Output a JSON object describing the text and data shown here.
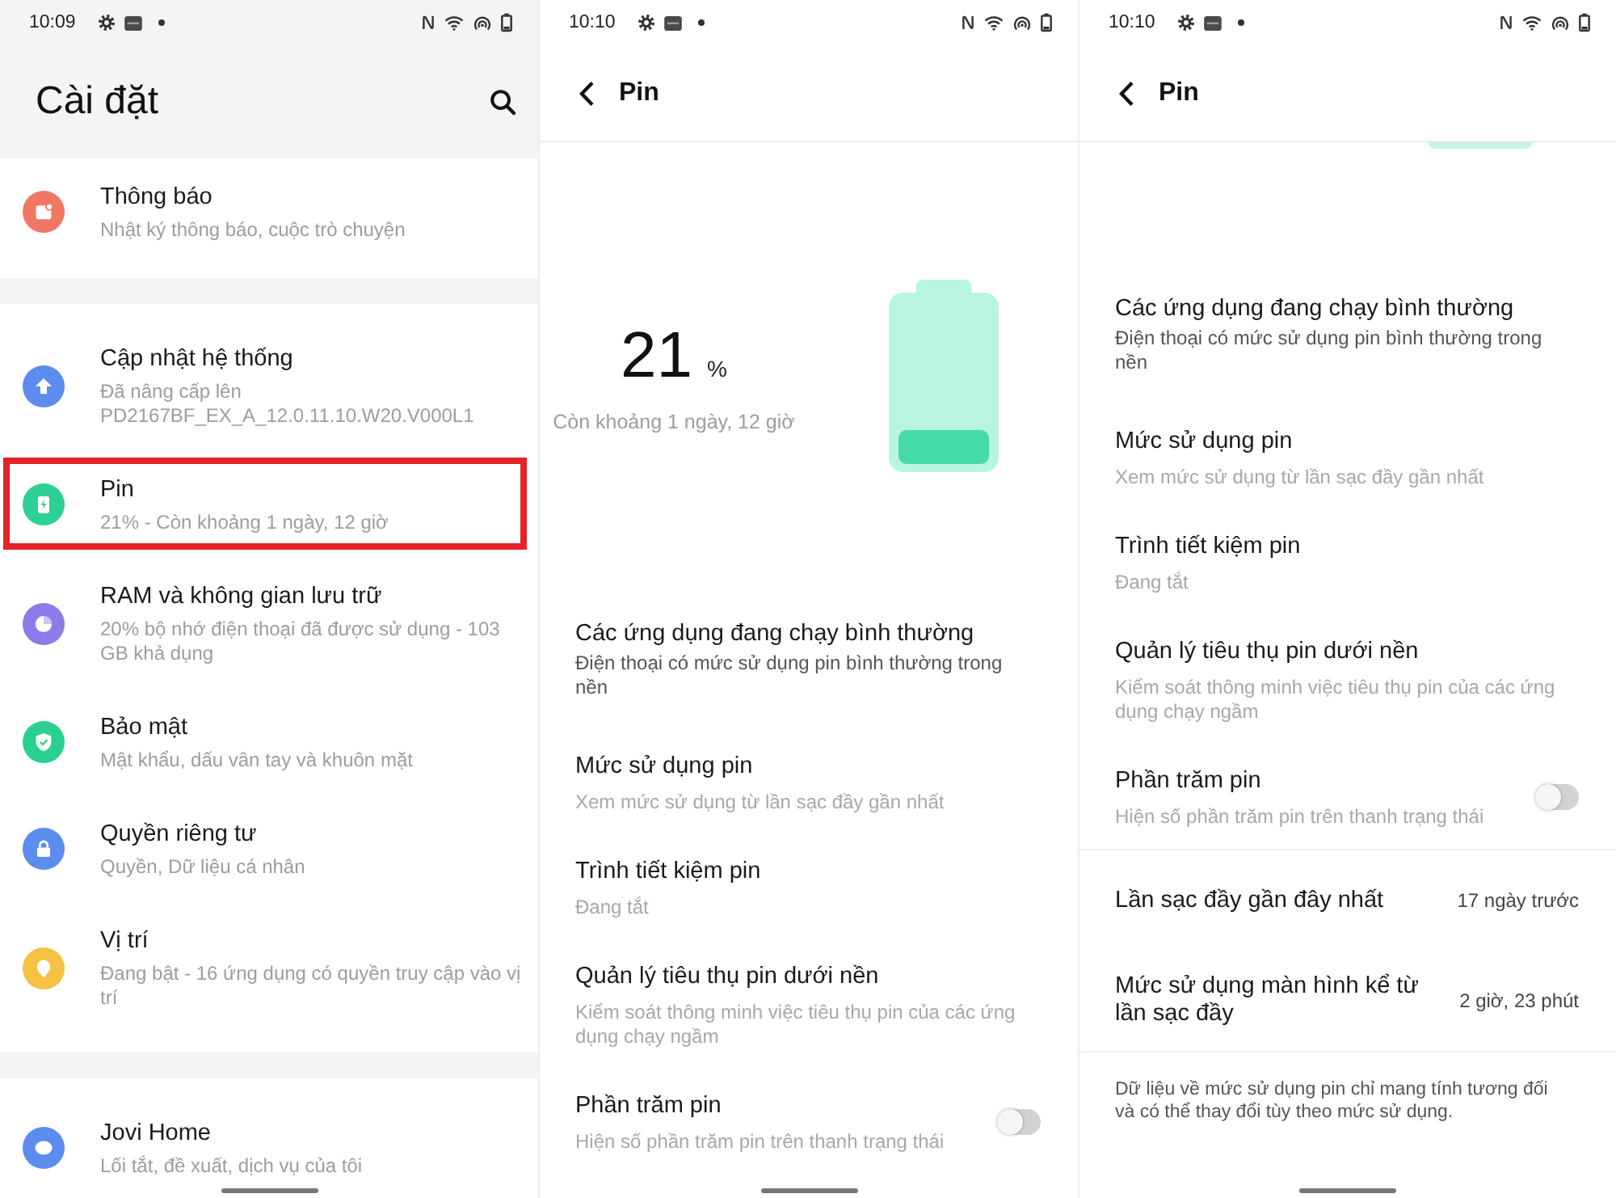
{
  "screens": [
    {
      "kind": "settings",
      "status_bar": {
        "time": "10:09"
      },
      "title": "Cài đặt",
      "groups": [
        {
          "items": [
            {
              "title": "Thông báo",
              "subtitle": "Nhật ký thông báo, cuộc trò chuyện",
              "color": "#f07862",
              "highlighted": false
            }
          ]
        },
        {
          "items": [
            {
              "title": "Cập nhật hệ thống",
              "subtitle": "Đã nâng cấp lên PD2167BF_EX_A_12.0.11.10.W20.V000L1",
              "color": "#5b8cee",
              "highlighted": false
            },
            {
              "title": "Pin",
              "subtitle": "21% - Còn khoảng 1 ngày, 12 giờ",
              "color": "#2dd095",
              "highlighted": true
            },
            {
              "title": "RAM và không gian lưu trữ",
              "subtitle": "20% bộ nhớ điện thoại đã được sử dụng - 103 GB khả dụng",
              "color": "#8e7be9",
              "highlighted": false
            },
            {
              "title": "Bảo mật",
              "subtitle": "Mật khẩu, dấu vân tay và khuôn mặt",
              "color": "#2ad08f",
              "highlighted": false
            },
            {
              "title": "Quyền riêng tư",
              "subtitle": "Quyền, Dữ liệu cá nhân",
              "color": "#5b8cee",
              "highlighted": false
            },
            {
              "title": "Vị trí",
              "subtitle": "Đang bật - 16 ứng dụng có quyền truy cập vào vị trí",
              "color": "#f6c244",
              "highlighted": false
            }
          ]
        },
        {
          "items": [
            {
              "title": "Jovi Home",
              "subtitle": "Lối tắt, đề xuất, dịch vụ của tôi",
              "color": "#5b8cee",
              "highlighted": false
            }
          ]
        }
      ]
    },
    {
      "kind": "battery",
      "status_bar": {
        "time": "10:10"
      },
      "title": "Pin",
      "summary": {
        "percent": "21",
        "unit": "%",
        "remaining": "Còn khoảng 1 ngày, 12 giờ",
        "level": 0.21
      },
      "groups": [
        {
          "items": [
            {
              "kind": "status",
              "title": "Các ứng dụng đang chạy bình thường",
              "subtitle": "Điện thoại có mức sử dụng pin bình thường trong nền"
            },
            {
              "kind": "nav",
              "title": "Mức sử dụng pin",
              "subtitle": "Xem mức sử dụng từ lần sạc đầy gần nhất"
            },
            {
              "kind": "nav",
              "title": "Trình tiết kiệm pin",
              "subtitle": "Đang tắt"
            },
            {
              "kind": "nav",
              "title": "Quản lý tiêu thụ pin dưới nền",
              "subtitle": "Kiểm soát thông minh việc tiêu thụ pin của các ứng dụng chạy ngầm"
            },
            {
              "kind": "toggle",
              "title": "Phần trăm pin",
              "subtitle": "Hiện số phần trăm pin trên thanh trạng thái",
              "on": false
            }
          ]
        }
      ]
    },
    {
      "kind": "battery_scrolled",
      "status_bar": {
        "time": "10:10"
      },
      "title": "Pin",
      "groups": [
        {
          "items": [
            {
              "kind": "status",
              "title": "Các ứng dụng đang chạy bình thường",
              "subtitle": "Điện thoại có mức sử dụng pin bình thường trong nền"
            },
            {
              "kind": "nav",
              "title": "Mức sử dụng pin",
              "subtitle": "Xem mức sử dụng từ lần sạc đầy gần nhất"
            },
            {
              "kind": "nav",
              "title": "Trình tiết kiệm pin",
              "subtitle": "Đang tắt"
            },
            {
              "kind": "nav",
              "title": "Quản lý tiêu thụ pin dưới nền",
              "subtitle": "Kiểm soát thông minh việc tiêu thụ pin của các ứng dụng chạy ngầm"
            },
            {
              "kind": "toggle",
              "title": "Phần trăm pin",
              "subtitle": "Hiện số phần trăm pin trên thanh trạng thái",
              "on": false
            }
          ]
        },
        {
          "items": [
            {
              "kind": "value",
              "title": "Lần sạc đầy gần đây nhất",
              "value": "17 ngày trước"
            },
            {
              "kind": "value",
              "title": "Mức sử dụng màn hình kể từ lần sạc đầy",
              "value": "2 giờ, 23 phút"
            }
          ]
        }
      ],
      "note": "Dữ liệu về mức sử dụng pin chỉ mang tính tương đối và có thể thay đổi tùy theo mức sử dụng."
    }
  ]
}
